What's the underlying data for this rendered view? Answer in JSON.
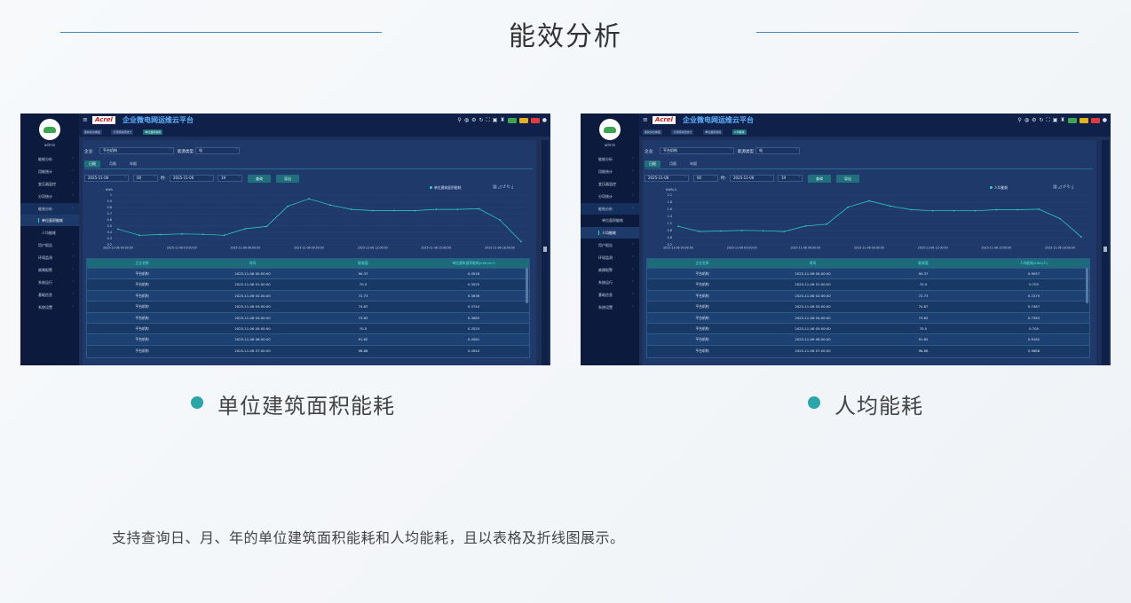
{
  "page": {
    "title": "能效分析",
    "description": "支持查询日、月、年的单位建筑面积能耗和人均能耗，且以表格及折线图展示。"
  },
  "colors": {
    "accent": "#2aa6a9",
    "line": "#2fd6c3",
    "panel": "#1d3058"
  },
  "app": {
    "brand": "Acrel",
    "title": "企业微电网运维云平台",
    "user": "admin",
    "badge_colors": [
      "#3aa552",
      "#e6b21c",
      "#e03a3a"
    ]
  },
  "sidebar": {
    "items": [
      {
        "label": "能耗分析"
      },
      {
        "label": "用能统计"
      },
      {
        "label": "变压器监控"
      },
      {
        "label": "分项统计"
      },
      {
        "label": "能效分析"
      },
      {
        "label": "用户报告"
      },
      {
        "label": "环境监测"
      },
      {
        "label": "故障报警"
      },
      {
        "label": "系统运行"
      },
      {
        "label": "基础信息"
      },
      {
        "label": "系统设置"
      }
    ],
    "subitems": [
      {
        "label": "单位面积能耗"
      },
      {
        "label": "人均能耗"
      }
    ]
  },
  "filters": {
    "company_label": "企业:",
    "company_value": "平台机构",
    "energy_label": "能源类型",
    "energy_value": "电",
    "periods": [
      "日报",
      "月报",
      "年报"
    ],
    "start_date": "2025-11-06",
    "start_hour": "00",
    "to_label": "时-",
    "end_date": "2025-11-06",
    "end_hour": "19",
    "query_label": "查询",
    "export_label": "导出"
  },
  "screens": [
    {
      "caption": "单位建筑面积能耗",
      "tabs": [
        "能耗综合看板",
        "分项能耗值统计",
        "单位面积能耗"
      ],
      "unit_label": "kWh",
      "legend": "单位建筑面积能耗",
      "col4": "单位建筑面积能耗(kWh/m²)",
      "chart_data": {
        "type": "line",
        "x": [
          "2025-11-06 00:00:00",
          "2025-11-06 01:00:00",
          "2025-11-06 02:00:00",
          "2025-11-06 03:00:00",
          "2025-11-06 04:00:00",
          "2025-11-06 05:00:00",
          "2025-11-06 06:00:00",
          "2025-11-06 07:00:00",
          "2025-11-06 08:00:00",
          "2025-11-06 09:00:00",
          "2025-11-06 10:00:00",
          "2025-11-06 11:00:00",
          "2025-11-06 12:00:00",
          "2025-11-06 13:00:00",
          "2025-11-06 14:00:00",
          "2025-11-06 15:00:00",
          "2025-11-06 16:00:00",
          "2025-11-06 17:00:00",
          "2025-11-06 18:00:00"
        ],
        "x_ticks": [
          "2025-11-06 00:00:00",
          "2025-11-06 03:00:00",
          "2025-11-06 06:00:00",
          "2025-11-06 09:00:00",
          "2025-11-06 12:00:00",
          "2025-11-06 15:00:00",
          "2025-11-06 18:00:00"
        ],
        "series": [
          {
            "values": [
              0.4518,
              0.3525,
              0.3636,
              0.3744,
              0.3682,
              0.3525,
              0.4581,
              0.4944,
              0.82,
              0.94,
              0.84,
              0.77,
              0.75,
              0.75,
              0.75,
              0.77,
              0.77,
              0.78,
              0.6,
              0.25
            ]
          }
        ],
        "y_ticks": [
          "0.2",
          "0.3",
          "0.4",
          "0.5",
          "0.6",
          "0.7",
          "0.8",
          "0.9",
          "1"
        ],
        "ylim": [
          0.2,
          1
        ]
      }
    },
    {
      "caption": "人均能耗",
      "tabs": [
        "能耗综合看板",
        "分项能耗值统计",
        "单位面积能耗",
        "人均能耗"
      ],
      "unit_label": "kWh/人",
      "legend": "人均能耗",
      "col4": "人均能耗(kWh/人)",
      "chart_data": {
        "type": "line",
        "x": [
          "2025-11-06 00:00:00",
          "2025-11-06 01:00:00",
          "2025-11-06 02:00:00",
          "2025-11-06 03:00:00",
          "2025-11-06 04:00:00",
          "2025-11-06 05:00:00",
          "2025-11-06 06:00:00",
          "2025-11-06 07:00:00",
          "2025-11-06 08:00:00",
          "2025-11-06 09:00:00",
          "2025-11-06 10:00:00",
          "2025-11-06 11:00:00",
          "2025-11-06 12:00:00",
          "2025-11-06 13:00:00",
          "2025-11-06 14:00:00",
          "2025-11-06 15:00:00",
          "2025-11-06 16:00:00",
          "2025-11-06 17:00:00",
          "2025-11-06 18:00:00"
        ],
        "x_ticks": [
          "2025-11-06 00:00:00",
          "2025-11-06 03:00:00",
          "2025-11-06 06:00:00",
          "2025-11-06 09:00:00",
          "2025-11-06 12:00:00",
          "2025-11-06 15:00:00",
          "2025-11-06 18:00:00"
        ],
        "series": [
          {
            "values": [
              0.9057,
              0.705,
              0.7275,
              0.7487,
              0.7363,
              0.705,
              0.9162,
              0.9888,
              1.64,
              1.88,
              1.68,
              1.54,
              1.5,
              1.5,
              1.5,
              1.54,
              1.54,
              1.56,
              1.2,
              0.5
            ]
          }
        ],
        "y_ticks": [
          "0.2",
          "0.6",
          "0.8",
          "1.2",
          "1.4",
          "1.6",
          "1.8",
          "2.1"
        ],
        "ylim": [
          0.2,
          2.1
        ]
      }
    }
  ],
  "table": {
    "col1": "企业名称",
    "col2": "时间",
    "col3": "能耗值",
    "rows": [
      {
        "org": "平台机构",
        "time": "2025-11-06 00:00:00",
        "energy": "90.37",
        "v1": "0.4518",
        "v2": "0.9057"
      },
      {
        "org": "平台机构",
        "time": "2025-11-06 01:00:00",
        "energy": "70.5",
        "v1": "0.3525",
        "v2": "0.705"
      },
      {
        "org": "平台机构",
        "time": "2025-11-06 02:00:00",
        "energy": "72.73",
        "v1": "0.3636",
        "v2": "0.7275"
      },
      {
        "org": "平台机构",
        "time": "2025-11-06 03:00:00",
        "energy": "74.87",
        "v1": "0.3744",
        "v2": "0.7487"
      },
      {
        "org": "平台机构",
        "time": "2025-11-06 04:00:00",
        "energy": "73.63",
        "v1": "0.3682",
        "v2": "0.7363"
      },
      {
        "org": "平台机构",
        "time": "2025-11-06 05:00:00",
        "energy": "70.5",
        "v1": "0.3525",
        "v2": "0.705"
      },
      {
        "org": "平台机构",
        "time": "2025-11-06 06:00:00",
        "energy": "91.62",
        "v1": "0.4581",
        "v2": "0.9162"
      },
      {
        "org": "平台机构",
        "time": "2025-11-06 07:00:00",
        "energy": "98.88",
        "v1": "0.4944",
        "v2": "0.9888"
      }
    ]
  }
}
